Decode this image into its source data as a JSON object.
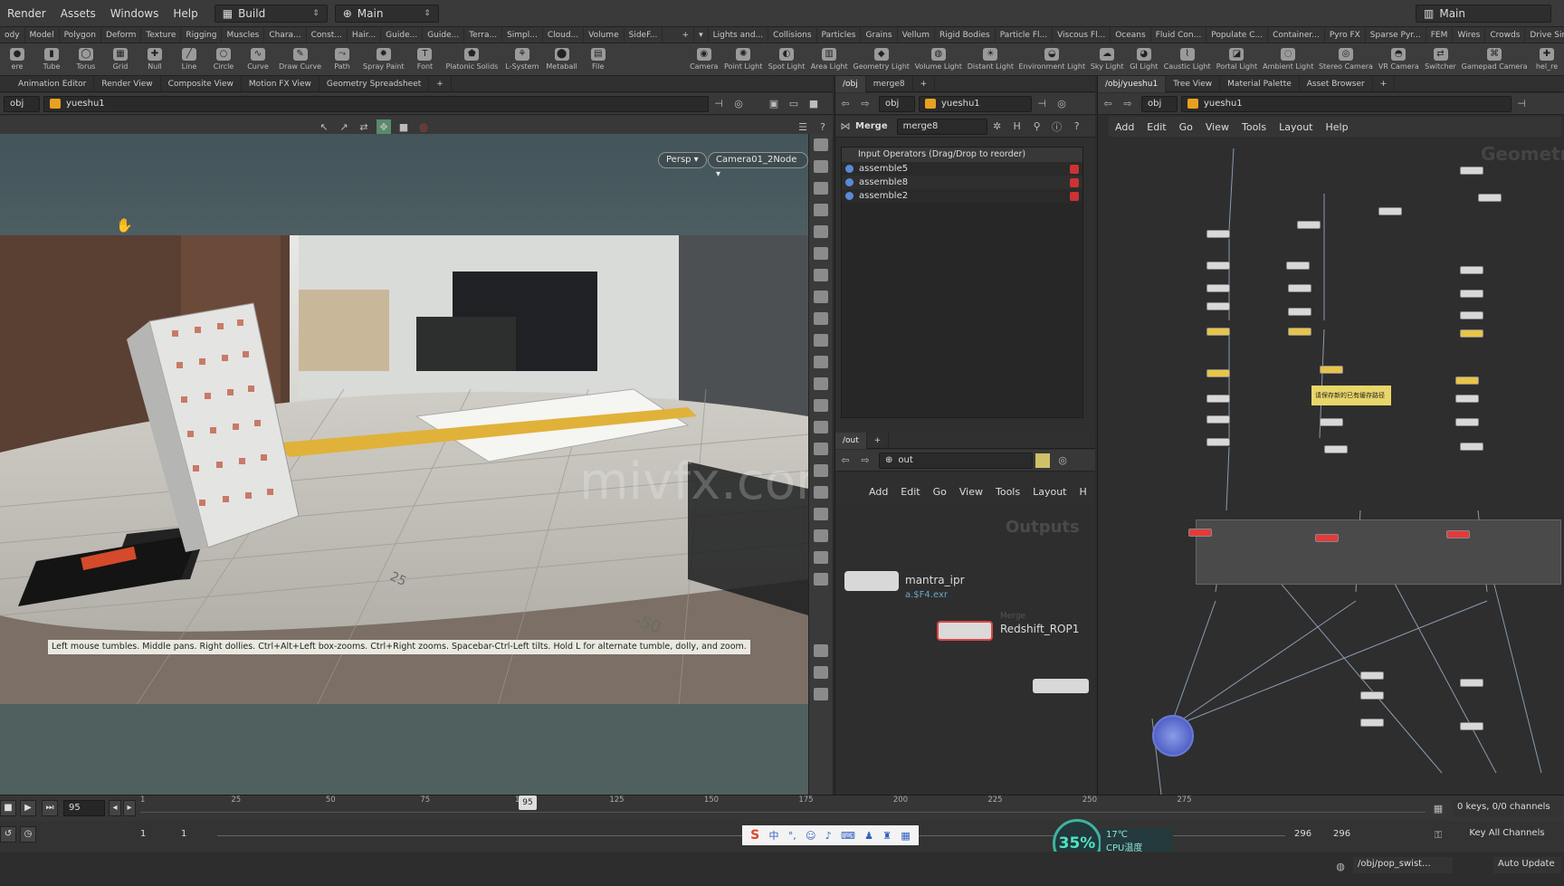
{
  "menubar": {
    "items": [
      "Render",
      "Assets",
      "Windows",
      "Help"
    ],
    "desktop": "Build",
    "network": "Main",
    "right_desktop": "Main"
  },
  "shelf_tabs_left": [
    "ody",
    "Model",
    "Polygon",
    "Deform",
    "Texture",
    "Rigging",
    "Muscles",
    "Chara...",
    "Const...",
    "Hair...",
    "Guide...",
    "Guide...",
    "Terra...",
    "Simpl...",
    "Cloud...",
    "Volume",
    "SideF..."
  ],
  "shelf_tabs_right": [
    "Lights and...",
    "Collisions",
    "Particles",
    "Grains",
    "Vellum",
    "Rigid Bodies",
    "Particle Fl...",
    "Viscous Fl...",
    "Oceans",
    "Fluid Con...",
    "Populate C...",
    "Container...",
    "Pyro FX",
    "Sparse Pyr...",
    "FEM",
    "Wires",
    "Crowds",
    "Drive Sim..."
  ],
  "tools_left": [
    {
      "l": "ere",
      "i": "●"
    },
    {
      "l": "Tube",
      "i": "▮"
    },
    {
      "l": "Torus",
      "i": "◯"
    },
    {
      "l": "Grid",
      "i": "▦"
    },
    {
      "l": "Null",
      "i": "✚"
    },
    {
      "l": "Line",
      "i": "╱"
    },
    {
      "l": "Circle",
      "i": "○"
    },
    {
      "l": "Curve",
      "i": "∿"
    },
    {
      "l": "Draw Curve",
      "i": "✎"
    },
    {
      "l": "Path",
      "i": "⤳"
    },
    {
      "l": "Spray Paint",
      "i": "✹"
    },
    {
      "l": "Font",
      "i": "T"
    },
    {
      "l": "Platonic Solids",
      "i": "⬟"
    },
    {
      "l": "L-System",
      "i": "⚘"
    },
    {
      "l": "Metaball",
      "i": "⬤"
    },
    {
      "l": "File",
      "i": "▤"
    }
  ],
  "tools_right": [
    {
      "l": "Camera",
      "i": "◉"
    },
    {
      "l": "Point Light",
      "i": "✺"
    },
    {
      "l": "Spot Light",
      "i": "◐"
    },
    {
      "l": "Area Light",
      "i": "▥"
    },
    {
      "l": "Geometry Light",
      "i": "◆"
    },
    {
      "l": "Volume Light",
      "i": "◍"
    },
    {
      "l": "Distant Light",
      "i": "☀"
    },
    {
      "l": "Environment Light",
      "i": "◒"
    },
    {
      "l": "Sky Light",
      "i": "☁"
    },
    {
      "l": "GI Light",
      "i": "◕"
    },
    {
      "l": "Caustic Light",
      "i": "⌇"
    },
    {
      "l": "Portal Light",
      "i": "◪"
    },
    {
      "l": "Ambient Light",
      "i": "◌"
    },
    {
      "l": "Stereo Camera",
      "i": "◎"
    },
    {
      "l": "VR Camera",
      "i": "◓"
    },
    {
      "l": "Switcher",
      "i": "⇄"
    },
    {
      "l": "Gamepad Camera",
      "i": "⌘"
    },
    {
      "l": "hel_re",
      "i": "✚"
    }
  ],
  "viewer": {
    "tabs": [
      "Animation Editor",
      "Render View",
      "Composite View",
      "Motion FX View",
      "Geometry Spreadsheet"
    ],
    "path_root": "obj",
    "path_node": "yueshu1",
    "persp": "Persp",
    "camera": "Camera01_2Node",
    "hint": "Left mouse tumbles. Middle pans. Right dollies. Ctrl+Alt+Left box-zooms. Ctrl+Right zooms. Spacebar-Ctrl-Left tilts. Hold L for alternate tumble, dolly, and zoom.",
    "watermark": "mivfx.com"
  },
  "params": {
    "tabs": [
      "/obj",
      "merge8"
    ],
    "path_root": "obj",
    "path_node": "yueshu1",
    "node_type": "Merge",
    "node_name": "merge8",
    "list_header": "Input Operators (Drag/Drop to reorder)",
    "inputs": [
      "assemble5",
      "assemble8",
      "assemble2"
    ]
  },
  "out_net": {
    "tabs": [
      "/out"
    ],
    "path": "out",
    "menu": [
      "Add",
      "Edit",
      "Go",
      "View",
      "Tools",
      "Layout",
      "H"
    ],
    "context_label": "Outputs",
    "nodes": [
      {
        "name": "mantra_ipr",
        "sub": "a.$F4.exr"
      },
      {
        "name": "Redshift_ROP1",
        "sub": "Merge"
      }
    ]
  },
  "obj_net": {
    "tabs": [
      "/obj/yueshu1",
      "Tree View",
      "Material Palette",
      "Asset Browser"
    ],
    "path_root": "obj",
    "path_node": "yueshu1",
    "menu": [
      "Add",
      "Edit",
      "Go",
      "View",
      "Tools",
      "Layout",
      "Help"
    ],
    "context_label": "Geometry",
    "note": "请保存新的已有缓存路径"
  },
  "timeline": {
    "current_frame": "95",
    "frame_marker": "95",
    "ticks": [
      "1",
      "25",
      "50",
      "75",
      "100",
      "125",
      "150",
      "175",
      "200",
      "225",
      "250",
      "275"
    ],
    "start": "1",
    "start2": "1",
    "end": "296",
    "end2": "296",
    "keys_info": "0 keys, 0/0 channels",
    "key_all": "Key All Channels",
    "auto_update": "Auto Update",
    "status_path": "/obj/pop_swist..."
  },
  "widget": {
    "cpu_percent": "35%",
    "temp": "17℃",
    "cpu_label": "CPU温度"
  }
}
